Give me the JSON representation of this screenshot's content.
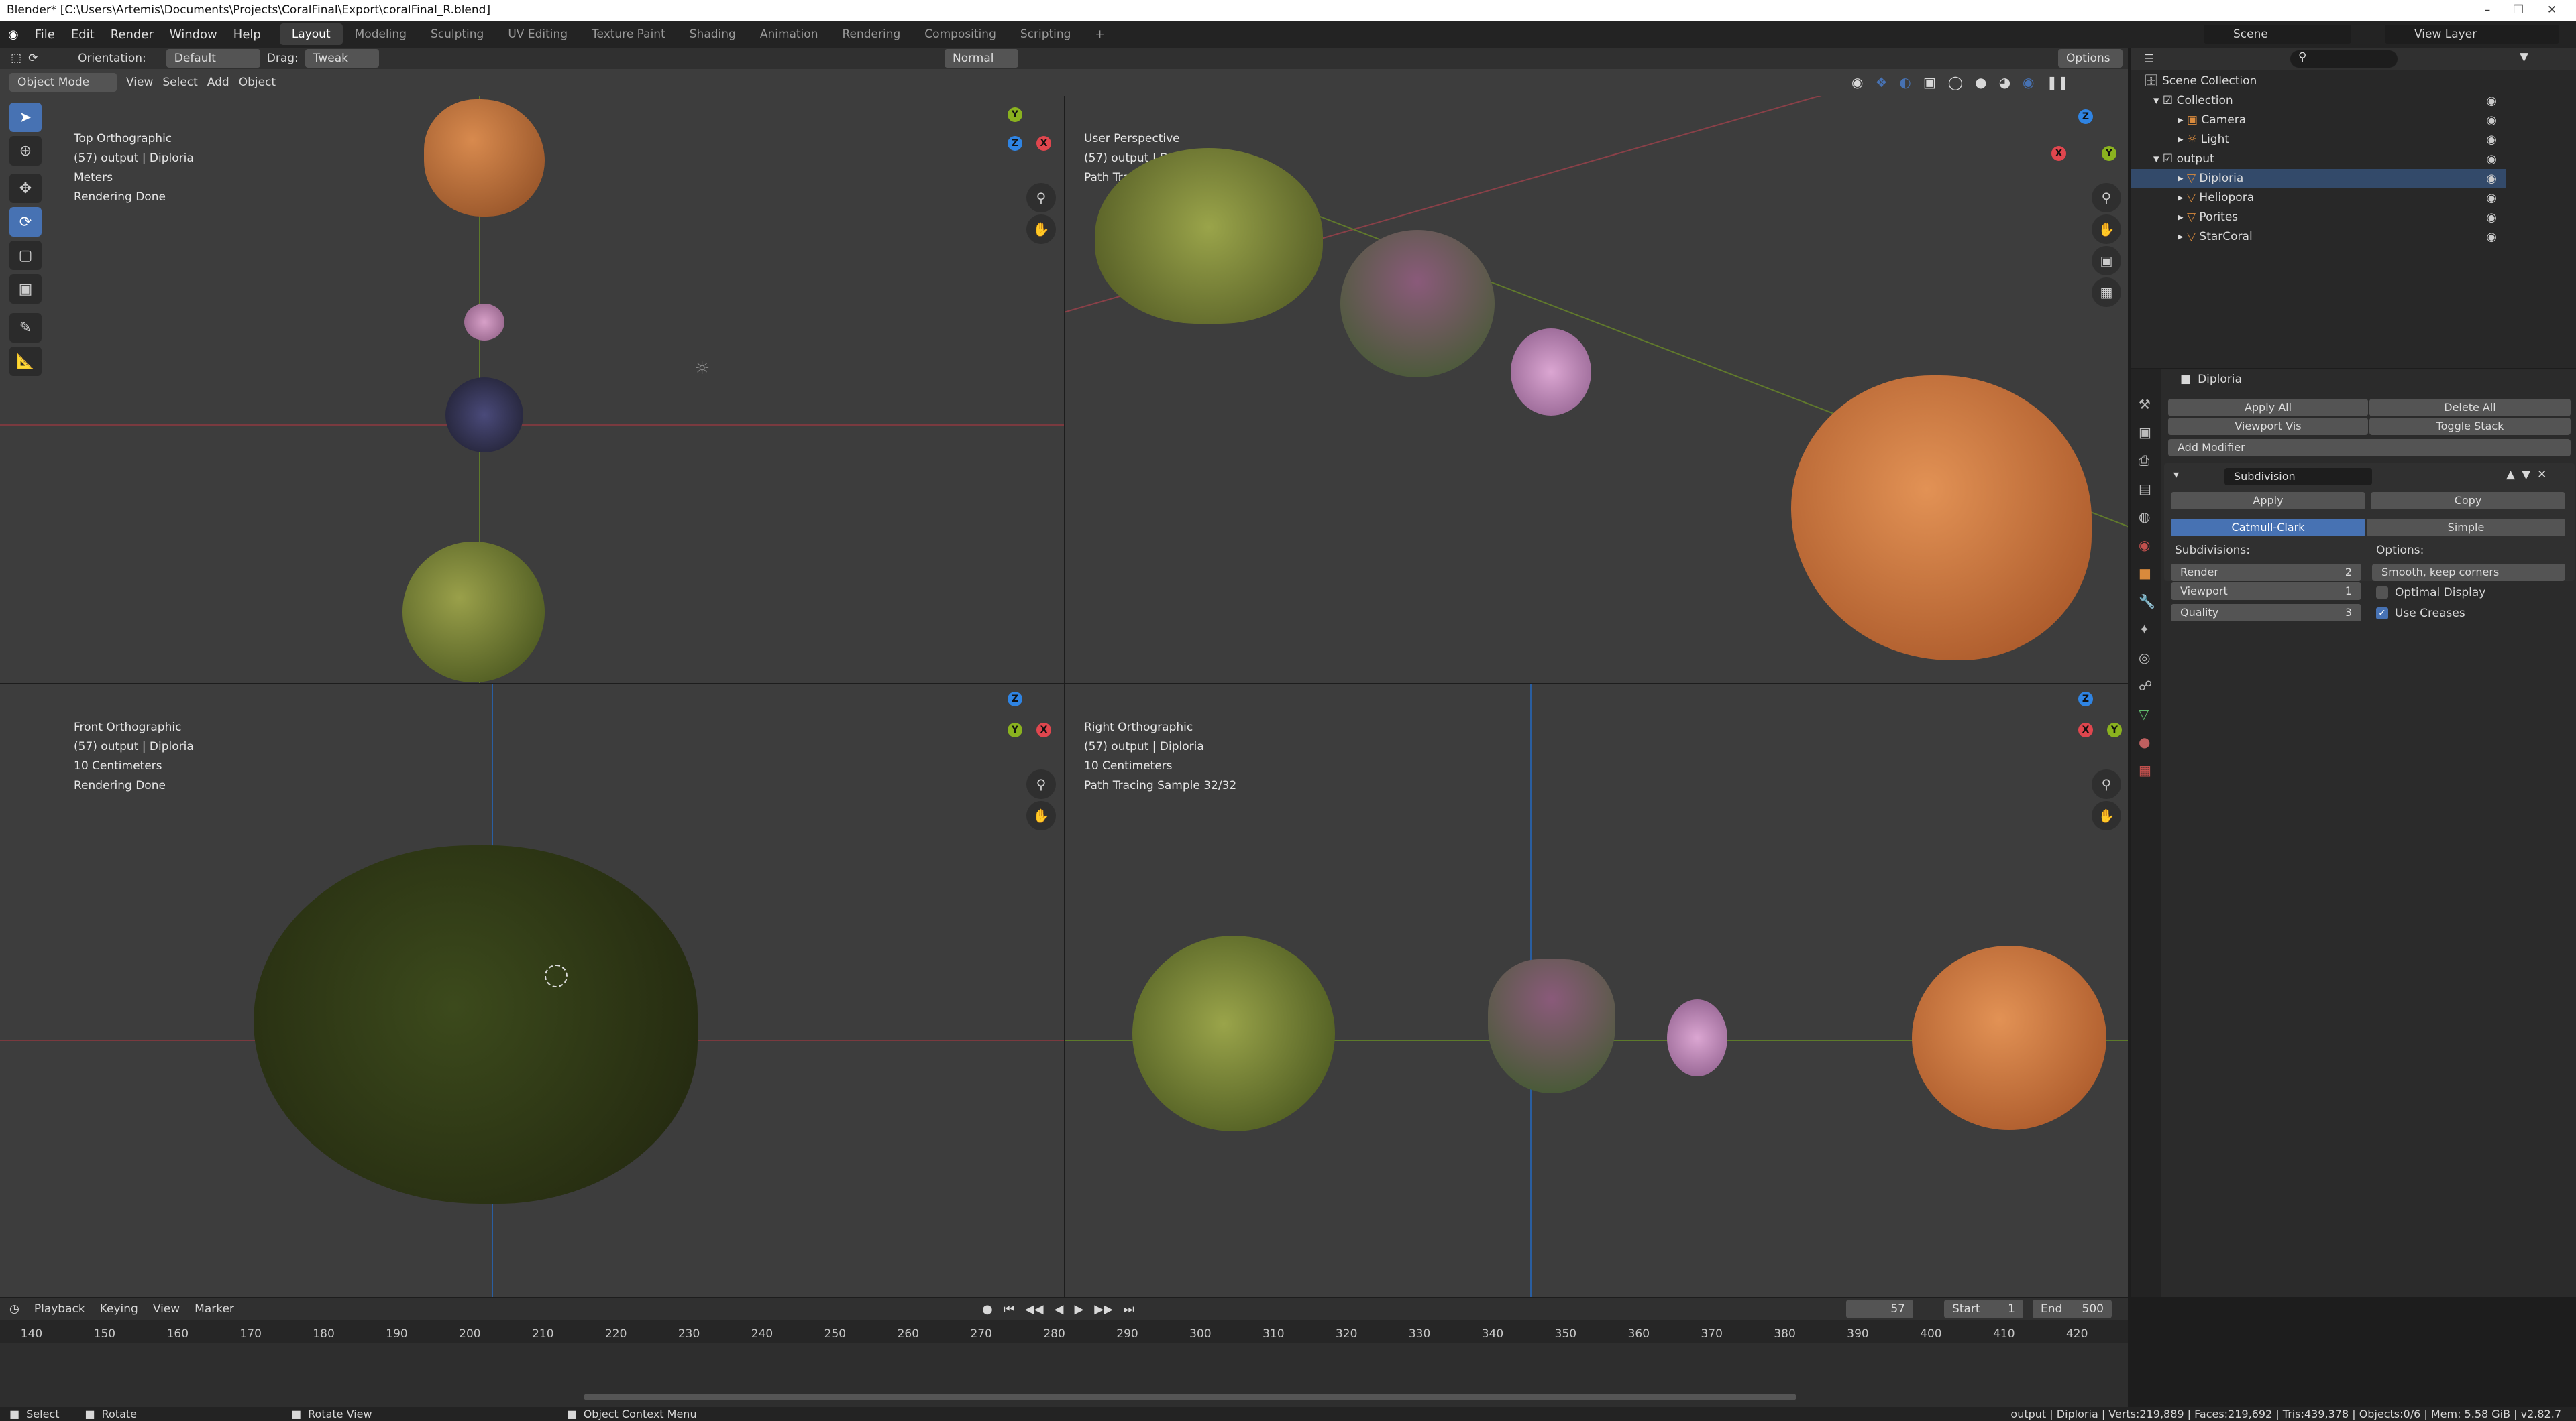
{
  "window": {
    "title": "Blender* [C:\\Users\\Artemis\\Documents\\Projects\\CoralFinal\\Export\\coralFinal_R.blend]"
  },
  "menus": [
    "File",
    "Edit",
    "Render",
    "Window",
    "Help"
  ],
  "workspaces": [
    "Layout",
    "Modeling",
    "Sculpting",
    "UV Editing",
    "Texture Paint",
    "Shading",
    "Animation",
    "Rendering",
    "Compositing",
    "Scripting"
  ],
  "active_workspace": "Layout",
  "scene": {
    "label": "Scene",
    "view_layer": "View Layer"
  },
  "tool_header": {
    "orientation_label": "Orientation:",
    "orientation_value": "Default",
    "drag_label": "Drag:",
    "drag_value": "Tweak",
    "transform": "Normal",
    "options": "Options"
  },
  "viewport_header": {
    "mode": "Object Mode",
    "view": "View",
    "select": "Select",
    "add": "Add",
    "object": "Object"
  },
  "viewports": {
    "top": {
      "name": "Top Orthographic",
      "object": "(57) output | Diploria",
      "units": "Meters",
      "status": "Rendering Done"
    },
    "persp": {
      "name": "User Perspective",
      "object": "(57) output | Diploria",
      "status": "Path Tracing Sample 20/32"
    },
    "front": {
      "name": "Front Orthographic",
      "object": "(57) output | Diploria",
      "units": "10 Centimeters",
      "status": "Rendering Done"
    },
    "right": {
      "name": "Right Orthographic",
      "object": "(57) output | Diploria",
      "units": "10 Centimeters",
      "status": "Path Tracing Sample 32/32"
    }
  },
  "outliner": {
    "root": "Scene Collection",
    "items": [
      {
        "label": "Collection"
      },
      {
        "label": "Camera"
      },
      {
        "label": "Light"
      },
      {
        "label": "output"
      },
      {
        "label": "Diploria"
      },
      {
        "label": "Heliopora"
      },
      {
        "label": "Porites"
      },
      {
        "label": "StarCoral"
      }
    ]
  },
  "properties": {
    "object": "Diploria",
    "apply_all": "Apply All",
    "delete_all": "Delete All",
    "viewport_vis": "Viewport Vis",
    "toggle_stack": "Toggle Stack",
    "add_modifier": "Add Modifier",
    "modifier_name": "Subdivision",
    "apply": "Apply",
    "copy": "Copy",
    "catmull": "Catmull-Clark",
    "simple": "Simple",
    "subdivisions_label": "Subdivisions:",
    "render_label": "Render",
    "render_value": "2",
    "viewport_label": "Viewport",
    "viewport_value": "1",
    "quality_label": "Quality",
    "quality_value": "3",
    "options_label": "Options:",
    "uv_smooth": "Smooth, keep corners",
    "optimal_display": "Optimal Display",
    "use_creases": "Use Creases"
  },
  "timeline": {
    "playback": "Playback",
    "keying": "Keying",
    "view": "View",
    "marker": "Marker",
    "current": "57",
    "start_label": "Start",
    "start": "1",
    "end_label": "End",
    "end": "500",
    "ticks": [
      "140",
      "150",
      "160",
      "170",
      "180",
      "190",
      "200",
      "210",
      "220",
      "230",
      "240",
      "250",
      "260",
      "270",
      "280",
      "290",
      "300",
      "310",
      "320",
      "330",
      "340",
      "350",
      "360",
      "370",
      "380",
      "390",
      "400",
      "410",
      "420"
    ]
  },
  "statusbar": {
    "select": "Select",
    "rotate": "Rotate",
    "rotate_view": "Rotate View",
    "context_menu": "Object Context Menu",
    "stats": "output | Diploria | Verts:219,889 | Faces:219,692 | Tris:439,378 | Objects:0/6 | Mem: 5.58 GiB | v2.82.7"
  },
  "colors": {
    "accent": "#4772b3",
    "axis_x": "#e0464e",
    "axis_y": "#8ab21f",
    "axis_z": "#2f84e3"
  }
}
